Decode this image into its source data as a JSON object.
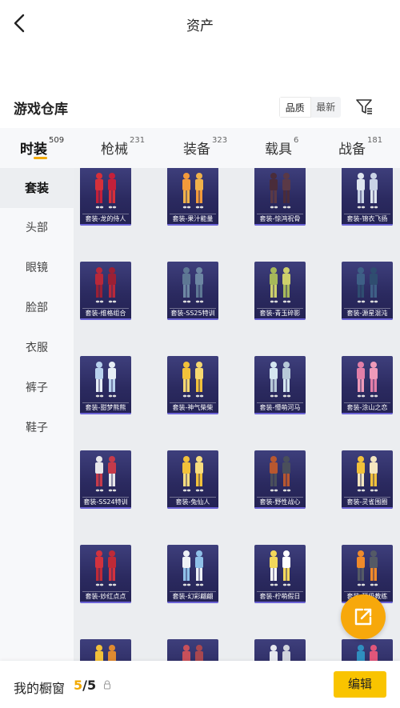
{
  "header": {
    "title": "资产"
  },
  "section": {
    "title": "游戏仓库"
  },
  "sort": {
    "options": [
      "品质",
      "最新"
    ],
    "active": "品质"
  },
  "tabs": [
    {
      "label": "时装",
      "count": "509",
      "active": true
    },
    {
      "label": "枪械",
      "count": "231"
    },
    {
      "label": "装备",
      "count": "323"
    },
    {
      "label": "载具",
      "count": "6"
    },
    {
      "label": "战备",
      "count": "181"
    }
  ],
  "sidebar": {
    "items": [
      {
        "label": "套装",
        "active": true
      },
      {
        "label": "头部"
      },
      {
        "label": "眼镜"
      },
      {
        "label": "脸部"
      },
      {
        "label": "衣服"
      },
      {
        "label": "裤子"
      },
      {
        "label": "鞋子"
      }
    ]
  },
  "items": [
    {
      "name": "套装-龙的侍人",
      "colors": [
        "#d6303a",
        "#c4203a"
      ]
    },
    {
      "name": "套装-果汁能量",
      "colors": [
        "#f39a3a",
        "#f0b24a"
      ]
    },
    {
      "name": "套装-惊鸿祝骨",
      "colors": [
        "#4a2c3a",
        "#5a3946"
      ]
    },
    {
      "name": "套装-锦衣飞扬",
      "colors": [
        "#dfe6ef",
        "#c9d3e6"
      ]
    },
    {
      "name": "套装-维格组合",
      "colors": [
        "#b8283a",
        "#9b2035"
      ]
    },
    {
      "name": "套装-SS25特训",
      "colors": [
        "#5e7894",
        "#6d87a3"
      ]
    },
    {
      "name": "套装-青玉碎影",
      "colors": [
        "#a6b85a",
        "#cdd06b"
      ]
    },
    {
      "name": "套装-源星混沌",
      "colors": [
        "#3e5f86",
        "#2f4d70"
      ]
    },
    {
      "name": "套装-甜梦熊熊",
      "colors": [
        "#b8d2ee",
        "#e7eef6"
      ]
    },
    {
      "name": "套装-神气柴柴",
      "colors": [
        "#f2c13a",
        "#f6d870"
      ]
    },
    {
      "name": "套装-懵萌河马",
      "colors": [
        "#d4e6f0",
        "#b7c9d8"
      ]
    },
    {
      "name": "套装-涂山之恋",
      "colors": [
        "#e37fa8",
        "#ee9ab9"
      ]
    },
    {
      "name": "套装-SS24特训",
      "colors": [
        "#e7e7ea",
        "#c63a4a"
      ]
    },
    {
      "name": "套装-兔仙人",
      "colors": [
        "#f2c13a",
        "#f7dc7e"
      ]
    },
    {
      "name": "套装-野性战心",
      "colors": [
        "#b8572f",
        "#4a4f5b"
      ]
    },
    {
      "name": "套装-灵雀围圈",
      "colors": [
        "#f2c13a",
        "#f4e6c0"
      ]
    },
    {
      "name": "套装-妙红点点",
      "colors": [
        "#d2323e",
        "#c02a37"
      ]
    },
    {
      "name": "套装-幻彩翩翩",
      "colors": [
        "#eef1f6",
        "#8fc0e8"
      ]
    },
    {
      "name": "套装-柠萌假日",
      "colors": [
        "#f3d85a",
        "#ffffff"
      ]
    },
    {
      "name": "套装-顶级教练",
      "colors": [
        "#f08a2a",
        "#545a66"
      ]
    },
    {
      "name": "",
      "colors": [
        "#f2c13a",
        "#e08a30"
      ]
    },
    {
      "name": "",
      "colors": [
        "#c8505a",
        "#a9474f"
      ]
    },
    {
      "name": "",
      "colors": [
        "#e6e8ee",
        "#d0d4dc"
      ]
    },
    {
      "name": "",
      "colors": [
        "#2f8fbf",
        "#e0567a"
      ]
    }
  ],
  "footer": {
    "label": "我的橱窗",
    "current": "5",
    "total": "/5",
    "edit_label": "编辑"
  },
  "colors": {
    "accent": "#f2a900",
    "edit_button": "#f9c400",
    "fab": "#f7a80b",
    "card_bg": "#2b2a60"
  },
  "icons": {
    "back": "chevron-left-icon",
    "filter": "filter-icon",
    "share": "share-external-icon",
    "lock": "lock-icon"
  }
}
